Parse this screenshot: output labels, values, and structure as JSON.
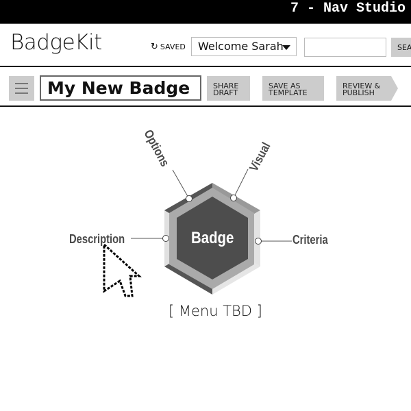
{
  "window": {
    "title": "7 - Nav Studio"
  },
  "header": {
    "logo": "BadgeKit",
    "saved_label": "SAVED",
    "user_menu": "Welcome Sarah",
    "search_value": "",
    "search_button": "SEA"
  },
  "toolbar": {
    "badge_name": "My New Badge",
    "share": [
      "SHARE",
      "DRAFT"
    ],
    "template": [
      "SAVE AS",
      "TEMPLATE"
    ],
    "publish": [
      "REVIEW &",
      "PUBLISH"
    ]
  },
  "diagram": {
    "center": "Badge",
    "options": "Options",
    "visual": "Visual",
    "description": "Description",
    "criteria": "Criteria",
    "footer": "[ Menu TBD ]"
  },
  "colors": {
    "hex_dark": "#4d4d4d",
    "hex_mid": "#aaaaaa",
    "button_bg": "#cccccc"
  }
}
